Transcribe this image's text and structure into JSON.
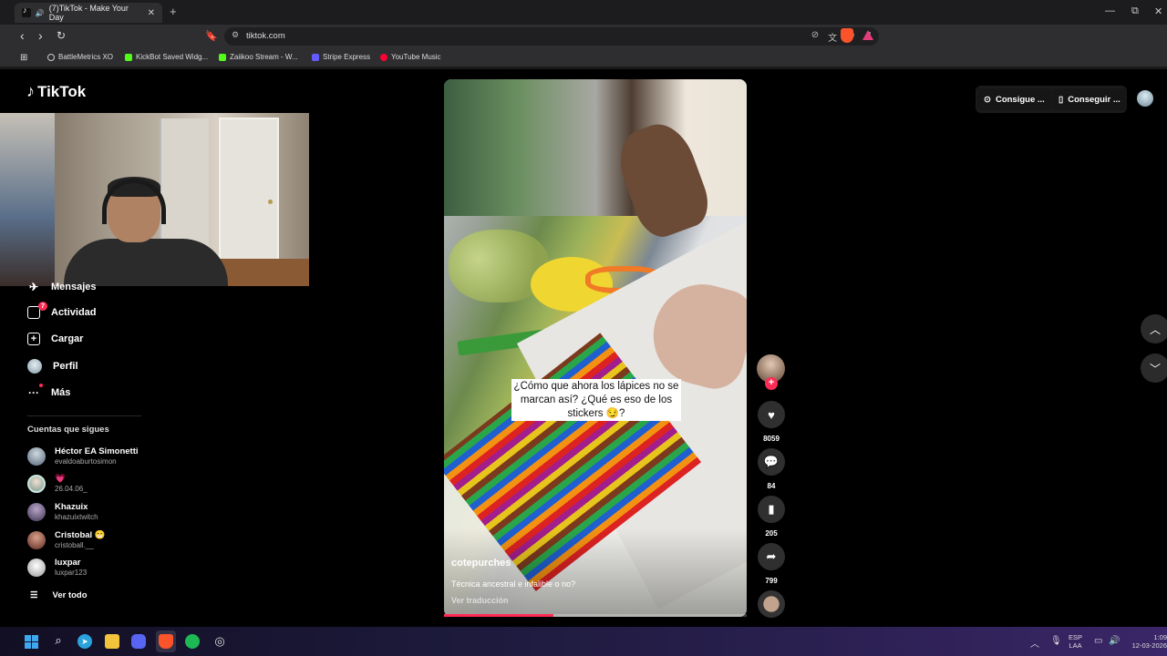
{
  "browser": {
    "tab_title": "(7)TikTok - Make Your Day",
    "tab_close": "✕",
    "new_tab": "+",
    "url": "tiktok.com",
    "win_min": "—",
    "win_max": "⧉",
    "win_close": "✕",
    "bookmarks": [
      {
        "label": "BattleMetrics XO",
        "color": "#555555"
      },
      {
        "label": "KickBot Saved Widg...",
        "color": "#53fc18"
      },
      {
        "label": "Zaiikoo Stream - W...",
        "color": "#53fc18"
      },
      {
        "label": "Stripe Express",
        "color": "#635bff"
      },
      {
        "label": "YouTube Music",
        "color": "#ff0033"
      }
    ]
  },
  "tiktok": {
    "logo": "TikTok",
    "nav": {
      "mensajes": "Mensajes",
      "actividad": "Actividad",
      "actividad_badge": "7",
      "cargar": "Cargar",
      "perfil": "Perfil",
      "mas": "Más"
    },
    "following_title": "Cuentas que sigues",
    "following": [
      {
        "name": "Héctor EA Simonetti",
        "handle": "evaldoaburtosimon",
        "color": "#6d7f8f"
      },
      {
        "name": "💗",
        "handle": "26.04.06_",
        "color": "#9bb0a8"
      },
      {
        "name": "Khazuix",
        "handle": "khazuixtwitch",
        "color": "#5a4f6e"
      },
      {
        "name": "Cristobal 😁",
        "handle": "cristoball.__",
        "color": "#8a4a3a"
      },
      {
        "name": "luxpar",
        "handle": "luxpar123",
        "color": "#eaeaea"
      }
    ],
    "see_all": "Ver todo",
    "video": {
      "caption": "¿Cómo que ahora los lápices no se marcan así? ¿Qué es eso de los stickers 😏?",
      "username": "cotepurches",
      "description": "Técnica ancestral e infalible o no?",
      "translate": "Ver traducción",
      "progress": 0.36
    },
    "actions": {
      "likes": "8059",
      "comments": "84",
      "saves": "205",
      "shares": "799"
    },
    "top_right": {
      "coins": "Consigue ...",
      "app": "Conseguir ..."
    }
  },
  "taskbar": {
    "lang_top": "ESP",
    "lang_bottom": "LAA",
    "time": "1:09",
    "date": "12-03-2026"
  }
}
